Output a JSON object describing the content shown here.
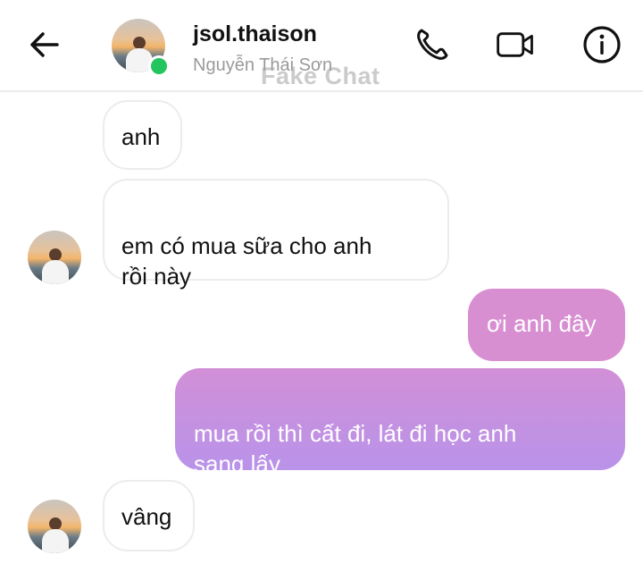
{
  "header": {
    "username": "jsol.thaison",
    "full_name": "Nguyễn Thái Sơn",
    "watermark": "Fake Chat",
    "online_color": "#22c55e",
    "icons": [
      "back-arrow-icon",
      "phone-icon",
      "video-camera-icon",
      "info-icon"
    ]
  },
  "messages": [
    {
      "direction": "incoming",
      "text": "anh"
    },
    {
      "direction": "incoming",
      "text": "em có mua sữa cho anh\nrồi này"
    },
    {
      "direction": "outgoing",
      "text": "ơi anh đây"
    },
    {
      "direction": "outgoing",
      "text": "mua rồi thì cất đi, lát đi học anh\nsang lấy"
    },
    {
      "direction": "incoming",
      "text": "vâng"
    }
  ],
  "colors": {
    "outgoing_top": "#d98ed0",
    "outgoing_bottom": "#b58fe8"
  }
}
